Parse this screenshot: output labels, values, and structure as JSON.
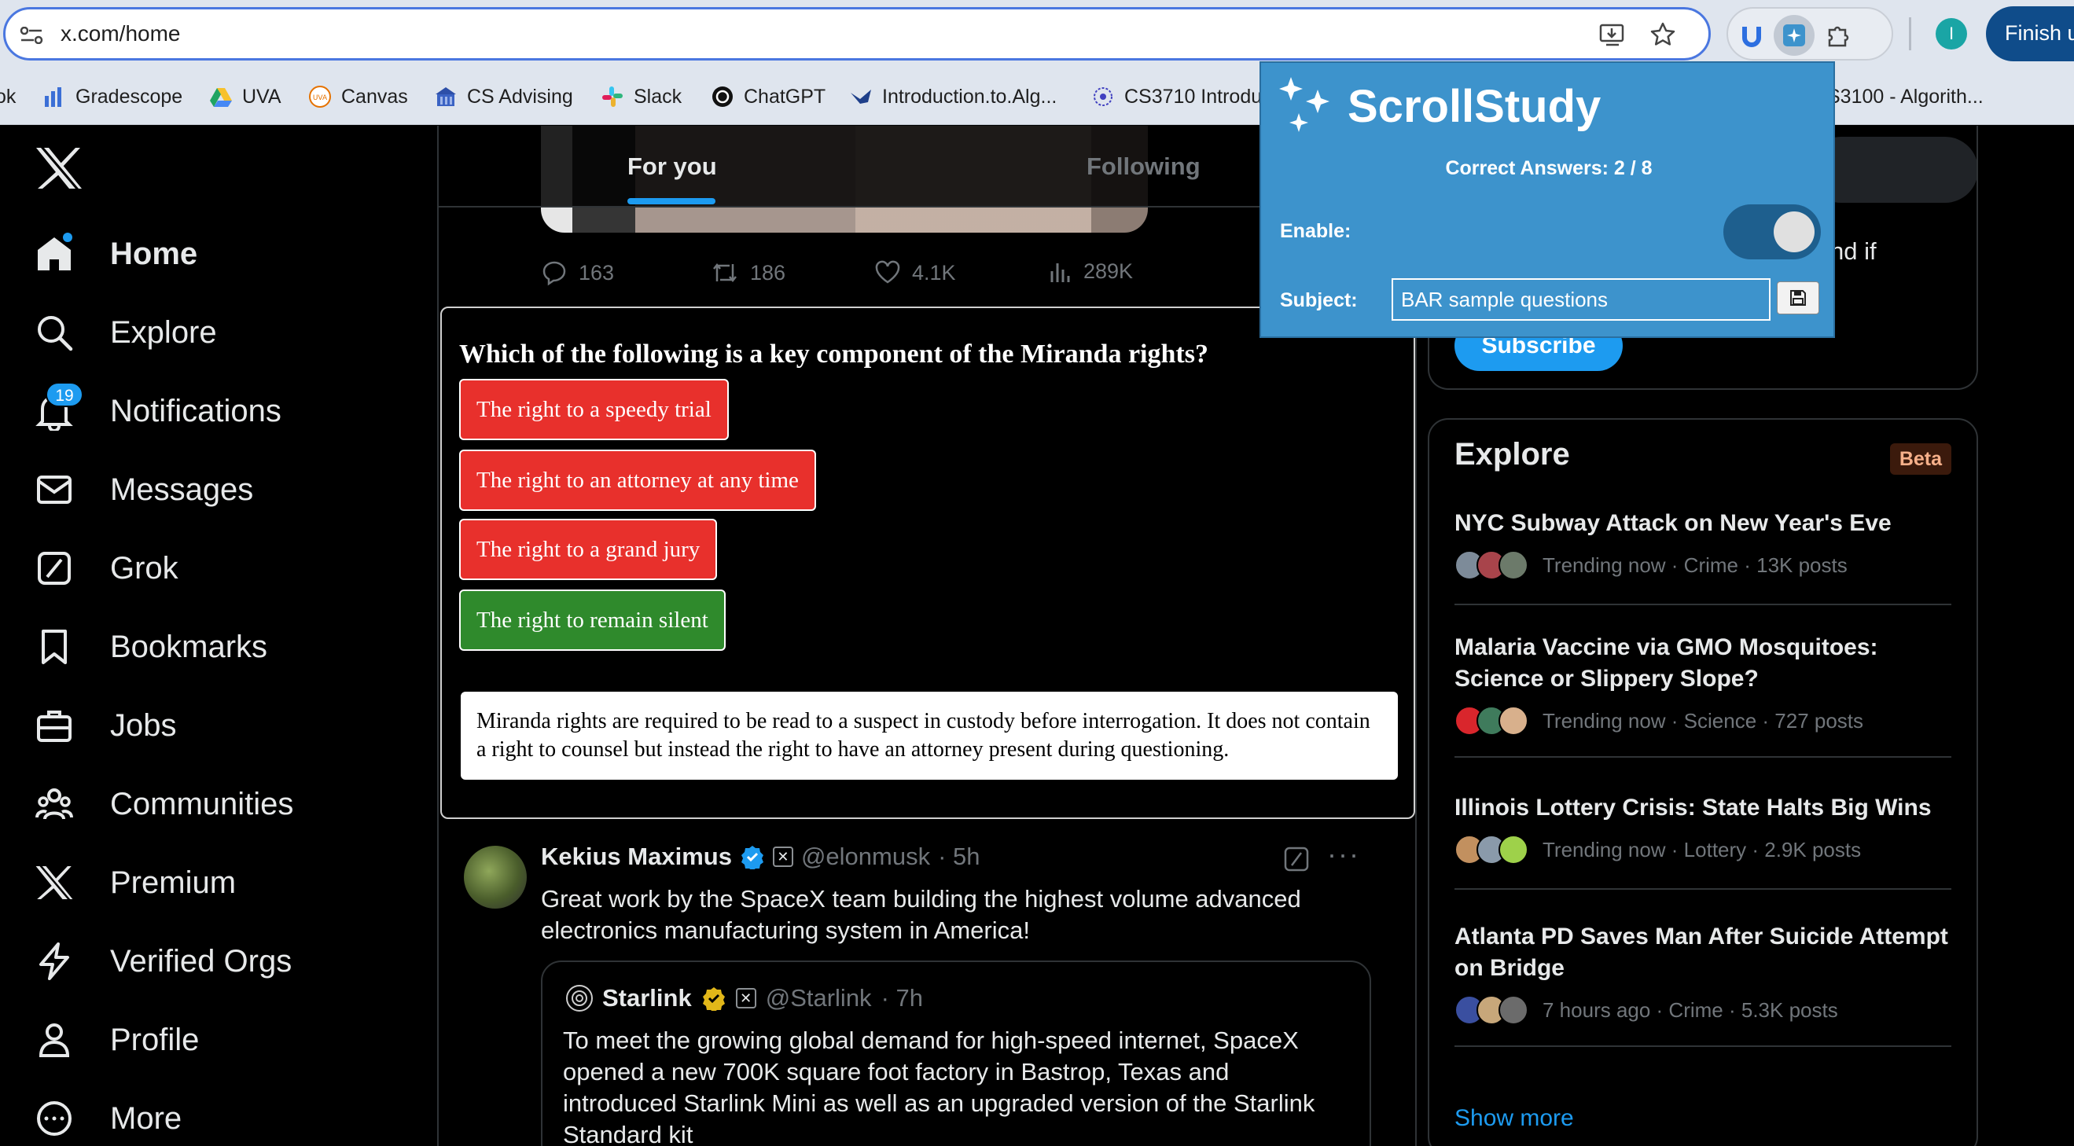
{
  "browser": {
    "url": "x.com/home",
    "finish_update_label": "Finish u",
    "profile_initial": "I",
    "bookmarks": [
      {
        "label": "ok"
      },
      {
        "label": "Gradescope"
      },
      {
        "label": "UVA"
      },
      {
        "label": "Canvas"
      },
      {
        "label": "CS Advising"
      },
      {
        "label": "Slack"
      },
      {
        "label": "ChatGPT"
      },
      {
        "label": "Introduction.to.Alg..."
      },
      {
        "label": "CS3710 Introdu"
      },
      {
        "label": "S3100 - Algorith..."
      }
    ]
  },
  "nav": {
    "items": [
      {
        "label": "Home",
        "icon": "home-icon"
      },
      {
        "label": "Explore",
        "icon": "search-icon"
      },
      {
        "label": "Notifications",
        "icon": "bell-icon",
        "badge": "19"
      },
      {
        "label": "Messages",
        "icon": "envelope-icon"
      },
      {
        "label": "Grok",
        "icon": "grok-icon"
      },
      {
        "label": "Bookmarks",
        "icon": "bookmark-icon"
      },
      {
        "label": "Jobs",
        "icon": "briefcase-icon"
      },
      {
        "label": "Communities",
        "icon": "people-icon"
      },
      {
        "label": "Premium",
        "icon": "x-icon"
      },
      {
        "label": "Verified Orgs",
        "icon": "lightning-icon"
      },
      {
        "label": "Profile",
        "icon": "person-icon"
      },
      {
        "label": "More",
        "icon": "more-circle-icon"
      }
    ]
  },
  "feed": {
    "tabs": [
      {
        "label": "For you"
      },
      {
        "label": "Following"
      }
    ],
    "actions": {
      "replies": "163",
      "reposts": "186",
      "likes": "4.1K",
      "views": "289K"
    }
  },
  "quiz": {
    "question": "Which of the following is a key component of the Miranda rights?",
    "options": [
      {
        "label": "The right to a speedy trial",
        "state": "wrong"
      },
      {
        "label": "The right to an attorney at any time",
        "state": "wrong"
      },
      {
        "label": "The right to a grand jury",
        "state": "wrong"
      },
      {
        "label": "The right to remain silent",
        "state": "correct"
      }
    ],
    "explanation": "Miranda rights are required to be read to a suspect in custody before interrogation. It does not contain a right to counsel but instead the right to have an attorney present during questioning."
  },
  "tweet": {
    "name": "Kekius Maximus",
    "handle": "@elonmusk",
    "time": "· 5h",
    "text": "Great work by the SpaceX team building the highest volume advanced electronics manufacturing system in America!",
    "quote": {
      "name": "Starlink",
      "handle": "@Starlink",
      "time": "· 7h",
      "text": "To meet the growing global demand for high-speed internet, SpaceX opened a new 700K square foot factory in Bastrop, Texas and introduced Starlink Mini as well as an upgraded version of the Starlink Standard kit"
    }
  },
  "right": {
    "premium_tail": "nd if",
    "subscribe_label": "Subscribe",
    "explore": {
      "title": "Explore",
      "beta": "Beta",
      "trends": [
        {
          "title": "NYC Subway Attack on New Year's Eve",
          "meta": "Trending now · Crime · 13K posts"
        },
        {
          "title": "Malaria Vaccine via GMO Mosquitoes: Science or Slippery Slope?",
          "meta": "Trending now · Science · 727 posts"
        },
        {
          "title": "Illinois Lottery Crisis: State Halts Big Wins",
          "meta": "Trending now · Lottery · 2.9K posts"
        },
        {
          "title": "Atlanta PD Saves Man After Suicide Attempt on Bridge",
          "meta": "7 hours ago · Crime · 5.3K posts"
        }
      ],
      "show_more": "Show more"
    }
  },
  "popup": {
    "title": "ScrollStudy",
    "score": "Correct Answers: 2 / 8",
    "enable_label": "Enable:",
    "enabled": true,
    "subject_label": "Subject:",
    "subject_value": "BAR sample questions"
  },
  "colors": {
    "accent": "#1d9bf0",
    "popup_bg": "#3d93cc",
    "wrong": "#e8302c",
    "correct": "#2f8a2c"
  }
}
